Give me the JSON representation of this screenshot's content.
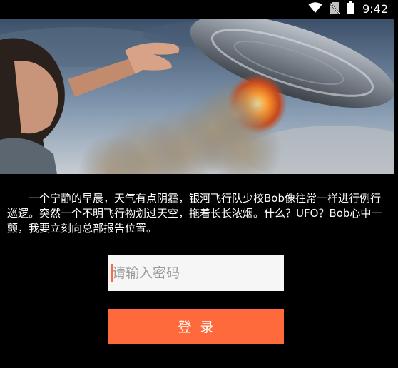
{
  "status_bar": {
    "time": "9:42",
    "icons": [
      "wifi-icon",
      "no-sim-icon",
      "battery-icon"
    ]
  },
  "banner": {
    "image": "ufo-scene-image"
  },
  "story": {
    "text": "一个宁静的早晨，天气有点阴霾，银河飞行队少校Bob像往常一样进行例行巡逻。突然一个不明飞行物划过天空，拖着长长浓烟。什么？UFO？Bob心中一颤，我要立刻向总部报告位置。"
  },
  "password": {
    "placeholder": "请输入密码",
    "value": ""
  },
  "login": {
    "label": "登录"
  },
  "colors": {
    "background": "#000000",
    "accent": "#ff6a3d",
    "input_background": "#f6f6f6"
  }
}
